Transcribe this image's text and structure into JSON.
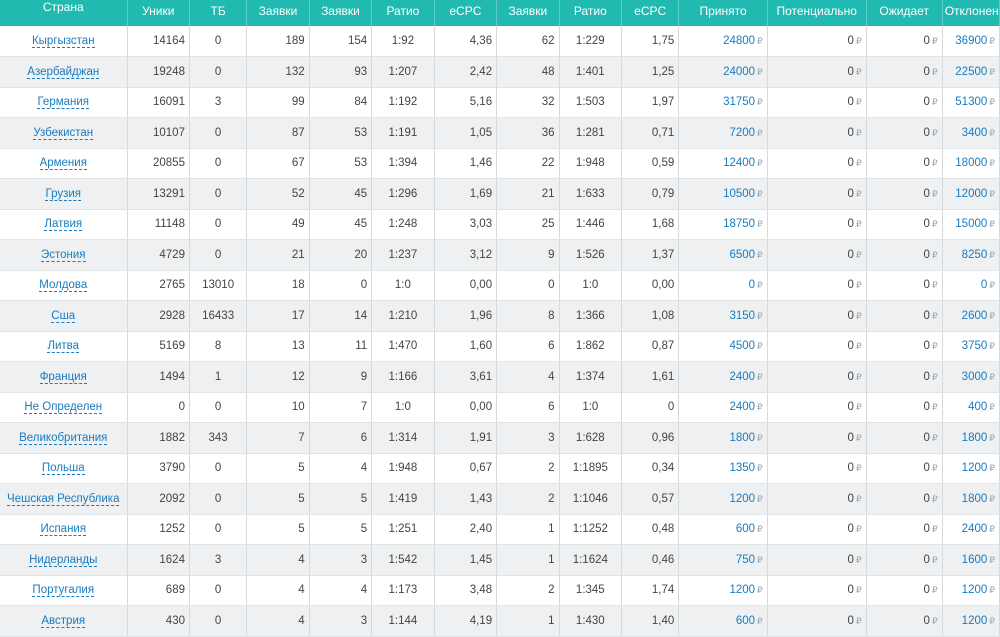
{
  "columns": [
    "Страна",
    "Уники",
    "ТБ",
    "Заявки",
    "Заявки",
    "Ратио",
    "eCPC",
    "Заявки",
    "Ратио",
    "eCPC",
    "Принято",
    "Потенциально",
    "Ожидает",
    "Отклонено"
  ],
  "currency_symbol": "₽",
  "rows": [
    [
      "Кыргызстан",
      "14164",
      "0",
      "189",
      "154",
      "1:92",
      "4,36",
      "62",
      "1:229",
      "1,75",
      "24800",
      "0",
      "0",
      "36900"
    ],
    [
      "Азербайджан",
      "19248",
      "0",
      "132",
      "93",
      "1:207",
      "2,42",
      "48",
      "1:401",
      "1,25",
      "24000",
      "0",
      "0",
      "22500"
    ],
    [
      "Германия",
      "16091",
      "3",
      "99",
      "84",
      "1:192",
      "5,16",
      "32",
      "1:503",
      "1,97",
      "31750",
      "0",
      "0",
      "51300"
    ],
    [
      "Узбекистан",
      "10107",
      "0",
      "87",
      "53",
      "1:191",
      "1,05",
      "36",
      "1:281",
      "0,71",
      "7200",
      "0",
      "0",
      "3400"
    ],
    [
      "Армения",
      "20855",
      "0",
      "67",
      "53",
      "1:394",
      "1,46",
      "22",
      "1:948",
      "0,59",
      "12400",
      "0",
      "0",
      "18000"
    ],
    [
      "Грузия",
      "13291",
      "0",
      "52",
      "45",
      "1:296",
      "1,69",
      "21",
      "1:633",
      "0,79",
      "10500",
      "0",
      "0",
      "12000"
    ],
    [
      "Латвия",
      "11148",
      "0",
      "49",
      "45",
      "1:248",
      "3,03",
      "25",
      "1:446",
      "1,68",
      "18750",
      "0",
      "0",
      "15000"
    ],
    [
      "Эстония",
      "4729",
      "0",
      "21",
      "20",
      "1:237",
      "3,12",
      "9",
      "1:526",
      "1,37",
      "6500",
      "0",
      "0",
      "8250"
    ],
    [
      "Молдова",
      "2765",
      "13010",
      "18",
      "0",
      "1:0",
      "0,00",
      "0",
      "1:0",
      "0,00",
      "0",
      "0",
      "0",
      "0"
    ],
    [
      "Сша",
      "2928",
      "16433",
      "17",
      "14",
      "1:210",
      "1,96",
      "8",
      "1:366",
      "1,08",
      "3150",
      "0",
      "0",
      "2600"
    ],
    [
      "Литва",
      "5169",
      "8",
      "13",
      "11",
      "1:470",
      "1,60",
      "6",
      "1:862",
      "0,87",
      "4500",
      "0",
      "0",
      "3750"
    ],
    [
      "Франция",
      "1494",
      "1",
      "12",
      "9",
      "1:166",
      "3,61",
      "4",
      "1:374",
      "1,61",
      "2400",
      "0",
      "0",
      "3000"
    ],
    [
      "Не Определен",
      "0",
      "0",
      "10",
      "7",
      "1:0",
      "0,00",
      "6",
      "1:0",
      "0",
      "2400",
      "0",
      "0",
      "400"
    ],
    [
      "Великобритания",
      "1882",
      "343",
      "7",
      "6",
      "1:314",
      "1,91",
      "3",
      "1:628",
      "0,96",
      "1800",
      "0",
      "0",
      "1800"
    ],
    [
      "Польша",
      "3790",
      "0",
      "5",
      "4",
      "1:948",
      "0,67",
      "2",
      "1:1895",
      "0,34",
      "1350",
      "0",
      "0",
      "1200"
    ],
    [
      "Чешская Республика",
      "2092",
      "0",
      "5",
      "5",
      "1:419",
      "1,43",
      "2",
      "1:1046",
      "0,57",
      "1200",
      "0",
      "0",
      "1800"
    ],
    [
      "Испания",
      "1252",
      "0",
      "5",
      "5",
      "1:251",
      "2,40",
      "1",
      "1:1252",
      "0,48",
      "600",
      "0",
      "0",
      "2400"
    ],
    [
      "Нидерланды",
      "1624",
      "3",
      "4",
      "3",
      "1:542",
      "1,45",
      "1",
      "1:1624",
      "0,46",
      "750",
      "0",
      "0",
      "1600"
    ],
    [
      "Португалия",
      "689",
      "0",
      "4",
      "4",
      "1:173",
      "3,48",
      "2",
      "1:345",
      "1,74",
      "1200",
      "0",
      "0",
      "1200"
    ],
    [
      "Австрия",
      "430",
      "0",
      "4",
      "3",
      "1:144",
      "4,19",
      "1",
      "1:430",
      "1,40",
      "600",
      "0",
      "0",
      "1200"
    ]
  ],
  "colors": {
    "header_bg": "#20bab1",
    "link": "#1a7bbf",
    "stripe": "#eef0f1"
  }
}
